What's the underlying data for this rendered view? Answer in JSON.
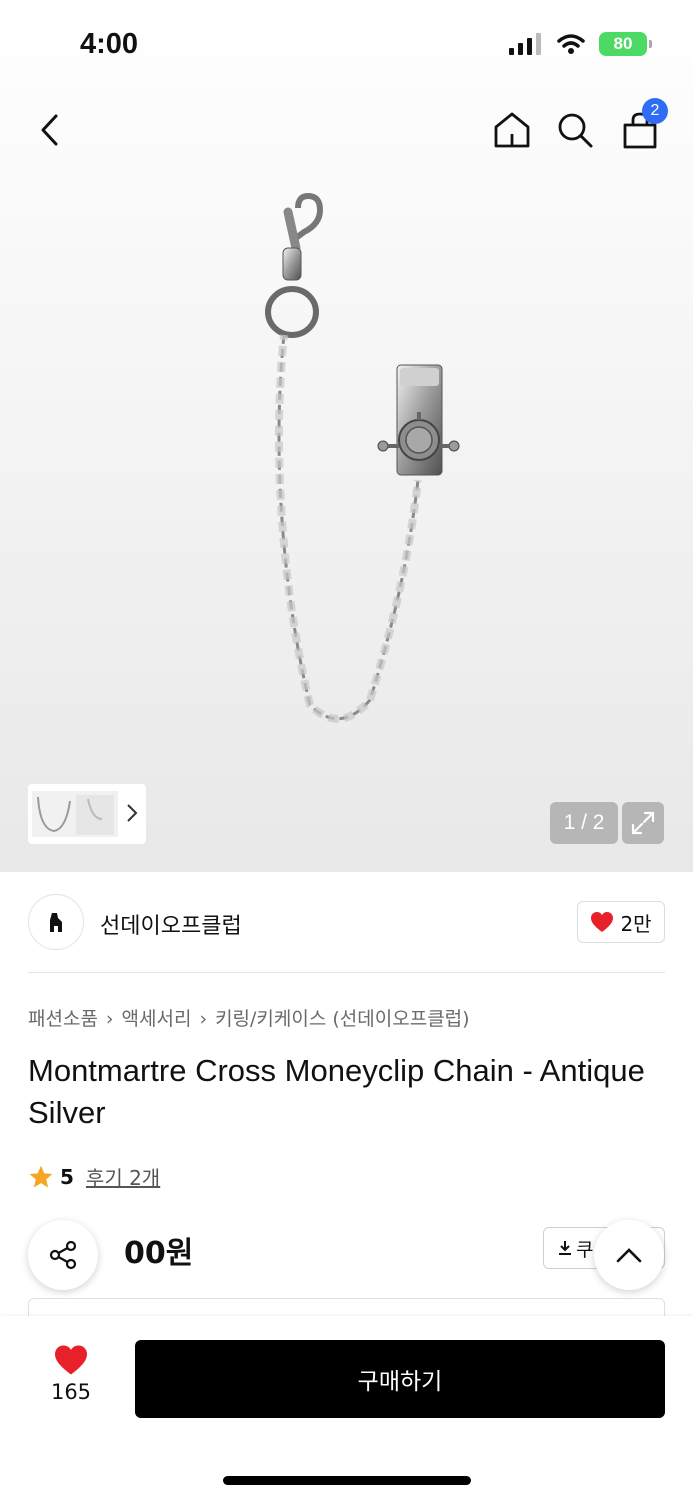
{
  "status_bar": {
    "time": "4:00",
    "battery": "80"
  },
  "nav": {
    "cart_count": "2"
  },
  "gallery": {
    "pager": "1 / 2"
  },
  "brand": {
    "name": "선데이오프클럽",
    "likes": "2만"
  },
  "breadcrumb": [
    "패션소품",
    "액세서리",
    "키링/키케이스 (선데이오프클럽)"
  ],
  "product": {
    "title": "Montmartre Cross Moneyclip Chain - Antique Silver",
    "rating": "5",
    "reviews": "후기 2개",
    "price_visible": "00원",
    "coupon_label": "쿠"
  },
  "bottom_bar": {
    "wish_count": "165",
    "buy_label": "구매하기"
  },
  "colors": {
    "accent_blue": "#2f6df6",
    "heart_red": "#e8202a",
    "star_orange": "#f5a623",
    "battery_green": "#4cd964"
  }
}
